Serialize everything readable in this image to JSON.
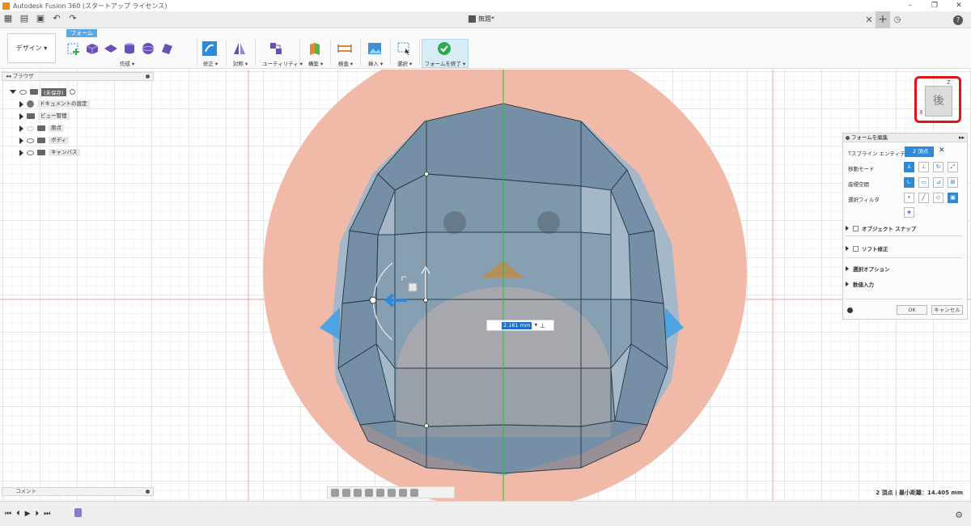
{
  "window": {
    "title": "Autodesk Fusion 360 (スタートアップ ライセンス)",
    "doc_title": "無題*"
  },
  "toolbar": {
    "workspace_label": "デザイン ▾",
    "active_tab": "フォーム",
    "groups": [
      {
        "label": "作成 ▾"
      },
      {
        "label": "修正 ▾"
      },
      {
        "label": "対称 ▾"
      },
      {
        "label": "ユーティリティ ▾"
      },
      {
        "label": "構築 ▾"
      },
      {
        "label": "検査 ▾"
      },
      {
        "label": "挿入 ▾"
      },
      {
        "label": "選択 ▾"
      },
      {
        "label": "フォームを終了 ▾"
      }
    ]
  },
  "browser": {
    "title": "ブラウザ",
    "items": [
      {
        "label": "(未保存)",
        "root": true
      },
      {
        "label": "ドキュメントの設定"
      },
      {
        "label": "ビュー管理"
      },
      {
        "label": "原点"
      },
      {
        "label": "ボディ"
      },
      {
        "label": "キャンバス"
      }
    ]
  },
  "comment": {
    "title": "コメント"
  },
  "edit_panel": {
    "title": "フォームを編集",
    "rows": [
      {
        "label": "Tスプライン エンティティ",
        "value": "2 頂点"
      },
      {
        "label": "移動モード"
      },
      {
        "label": "座標空間"
      },
      {
        "label": "選択フィルタ"
      }
    ],
    "sections": [
      {
        "label": "オブジェクト スナップ"
      },
      {
        "label": "ソフト修正"
      },
      {
        "label": "選択オプション"
      },
      {
        "label": "数値入力"
      }
    ],
    "ok": "OK",
    "cancel": "キャンセル"
  },
  "viewcube": {
    "face": "後",
    "axis_z": "Z",
    "axis_x": "X"
  },
  "dimension": {
    "value": "2.161 mm"
  },
  "status": {
    "text": "2 頂点 | 最小距離：14.405 mm"
  },
  "colors": {
    "accent": "#2c8ad8",
    "highlight": "#e0131a",
    "canvas_image": "#f0b9a8"
  }
}
